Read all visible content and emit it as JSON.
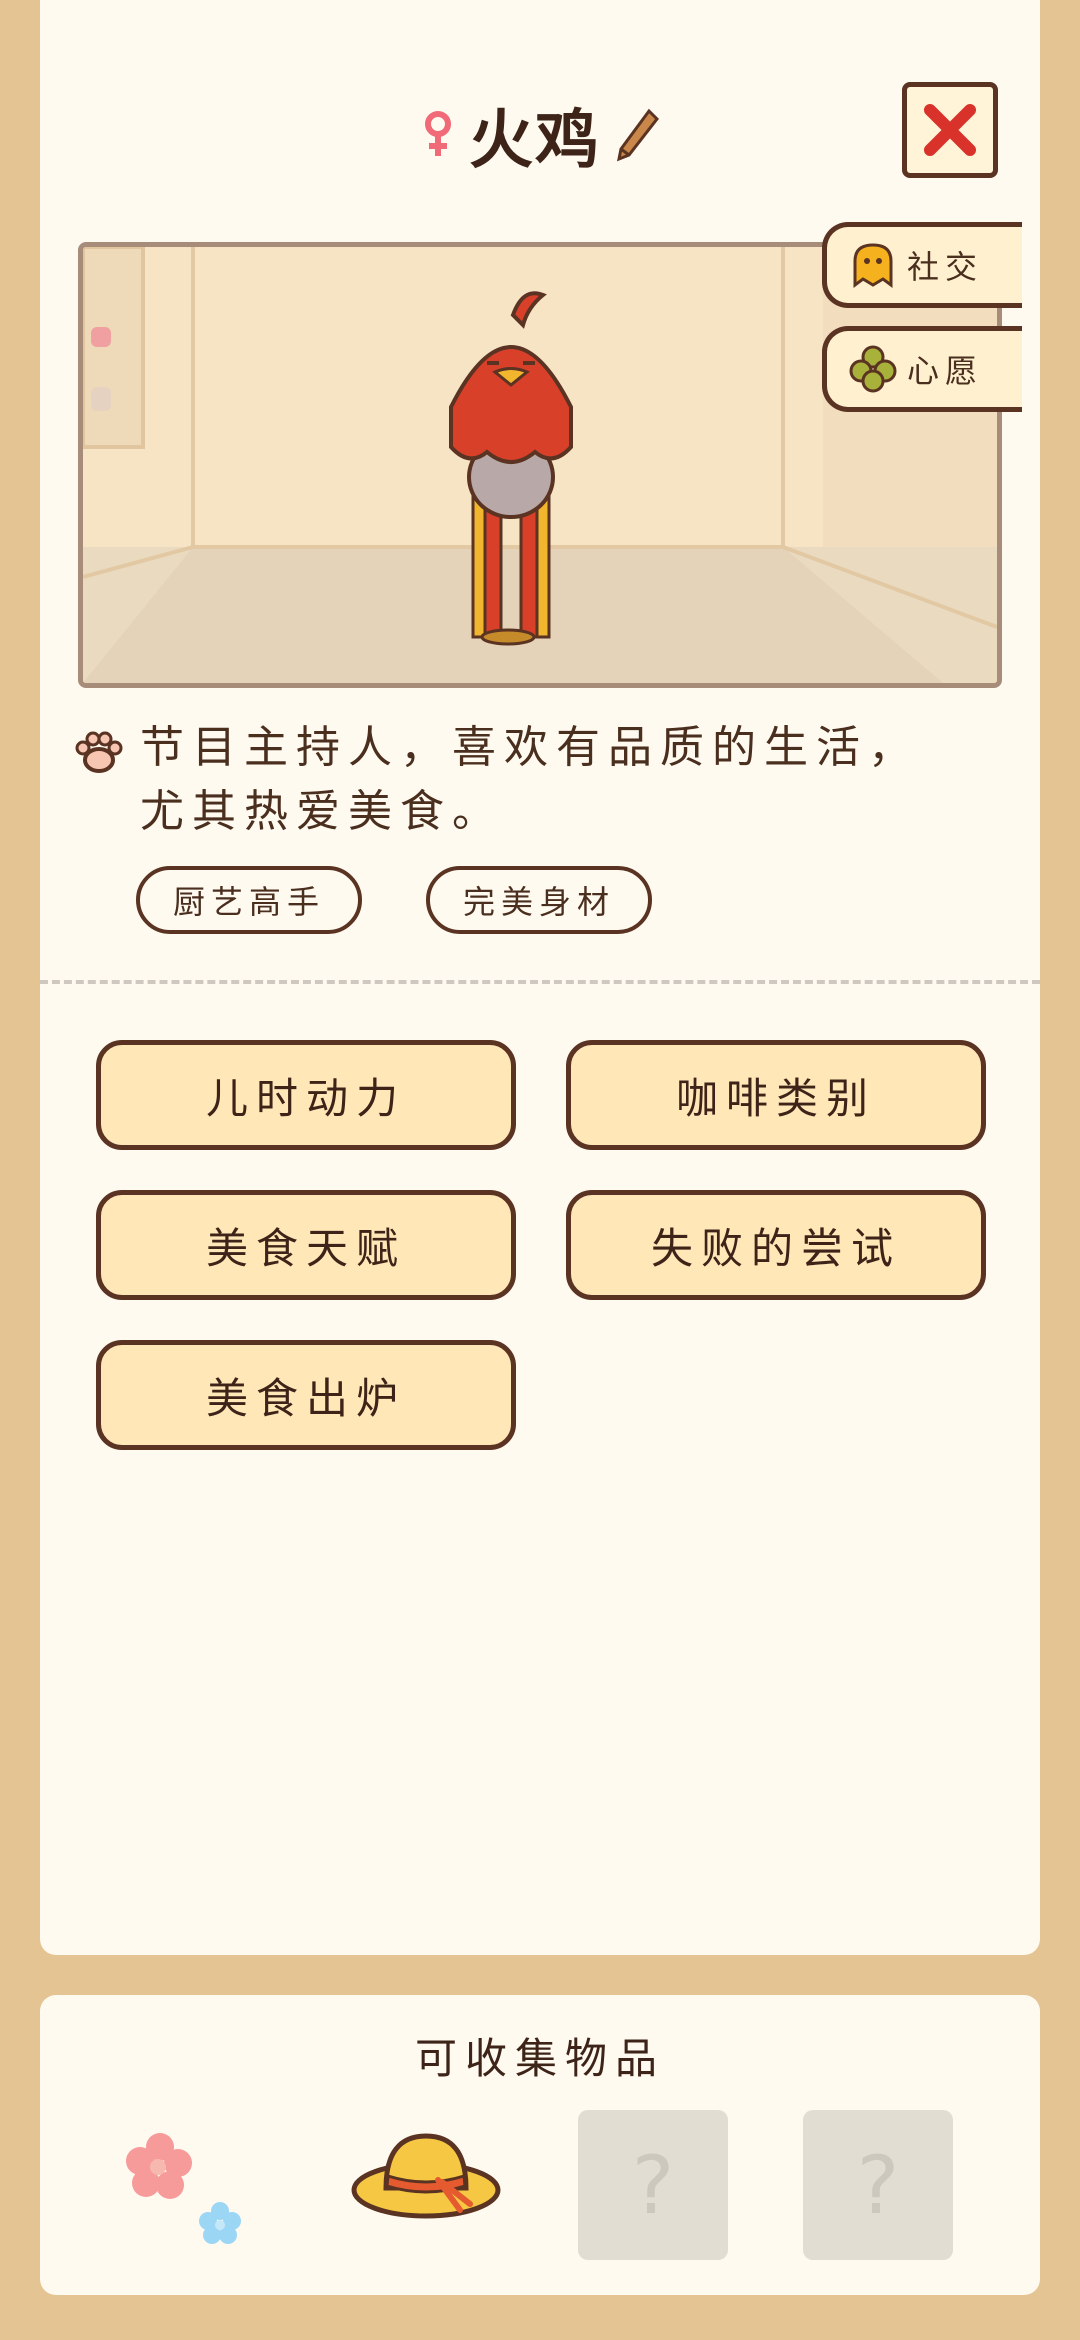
{
  "header": {
    "name": "火鸡"
  },
  "side_buttons": [
    {
      "label": "社交",
      "icon": "ghost-icon"
    },
    {
      "label": "心愿",
      "icon": "clover-icon"
    }
  ],
  "profile": {
    "description_line1": "节目主持人，喜欢有品质的生活，",
    "description_line2": "尤其热爱美食。",
    "tags": [
      "厨艺高手",
      "完美身材"
    ]
  },
  "stories": [
    "儿时动力",
    "咖啡类别",
    "美食天赋",
    "失败的尝试",
    "美食出炉"
  ],
  "collectibles": {
    "title": "可收集物品",
    "unknown_mark": "?"
  },
  "colors": {
    "background": "#E5C493",
    "card": "#FFFAF0",
    "button": "#FFE7B8",
    "outline": "#5A3322",
    "close_x": "#D8322A"
  }
}
